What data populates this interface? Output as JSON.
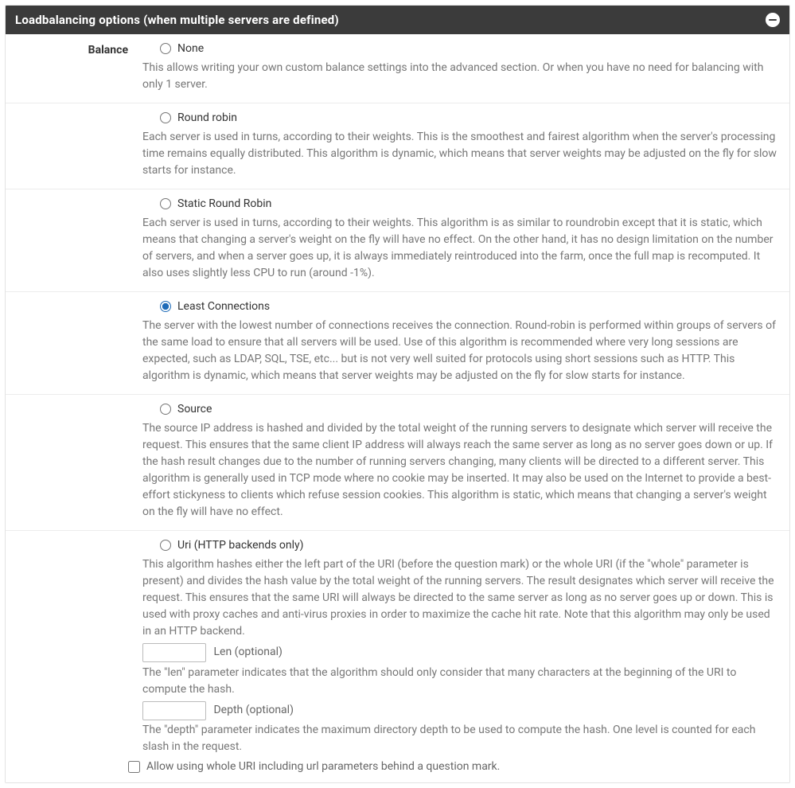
{
  "header": {
    "title": "Loadbalancing options (when multiple servers are defined)"
  },
  "balance": {
    "label": "Balance",
    "selected": "least_connections",
    "options": {
      "none": {
        "label": "None",
        "desc": "This allows writing your own custom balance settings into the advanced section. Or when you have no need for balancing with only 1 server."
      },
      "roundrobin": {
        "label": "Round robin",
        "desc": "Each server is used in turns, according to their weights. This is the smoothest and fairest algorithm when the server's processing time remains equally distributed. This algorithm is dynamic, which means that server weights may be adjusted on the fly for slow starts for instance."
      },
      "static_rr": {
        "label": "Static Round Robin",
        "desc": "Each server is used in turns, according to their weights. This algorithm is as similar to roundrobin except that it is static, which means that changing a server's weight on the fly will have no effect. On the other hand, it has no design limitation on the number of servers, and when a server goes up, it is always immediately reintroduced into the farm, once the full map is recomputed. It also uses slightly less CPU to run (around -1%)."
      },
      "least_connections": {
        "label": "Least Connections",
        "desc": "The server with the lowest number of connections receives the connection. Round-robin is performed within groups of servers of the same load to ensure that all servers will be used. Use of this algorithm is recommended where very long sessions are expected, such as LDAP, SQL, TSE, etc... but is not very well suited for protocols using short sessions such as HTTP. This algorithm is dynamic, which means that server weights may be adjusted on the fly for slow starts for instance."
      },
      "source": {
        "label": "Source",
        "desc": "The source IP address is hashed and divided by the total weight of the running servers to designate which server will receive the request. This ensures that the same client IP address will always reach the same server as long as no server goes down or up. If the hash result changes due to the number of running servers changing, many clients will be directed to a different server. This algorithm is generally used in TCP mode where no cookie may be inserted. It may also be used on the Internet to provide a best-effort stickyness to clients which refuse session cookies. This algorithm is static, which means that changing a server's weight on the fly will have no effect."
      },
      "uri": {
        "label": "Uri (HTTP backends only)",
        "desc": "This algorithm hashes either the left part of the URI (before the question mark) or the whole URI (if the \"whole\" parameter is present) and divides the hash value by the total weight of the running servers. The result designates which server will receive the request. This ensures that the same URI will always be directed to the same server as long as no server goes up or down. This is used with proxy caches and anti-virus proxies in order to maximize the cache hit rate. Note that this algorithm may only be used in an HTTP backend.",
        "len_label": "Len (optional)",
        "len_value": "",
        "len_help": "The \"len\" parameter indicates that the algorithm should only consider that many characters at the beginning of the URI to compute the hash.",
        "depth_label": "Depth (optional)",
        "depth_value": "",
        "depth_help": "The \"depth\" parameter indicates the maximum directory depth to be used to compute the hash. One level is counted for each slash in the request.",
        "whole_label": "Allow using whole URI including url parameters behind a question mark.",
        "whole_checked": false
      }
    }
  }
}
